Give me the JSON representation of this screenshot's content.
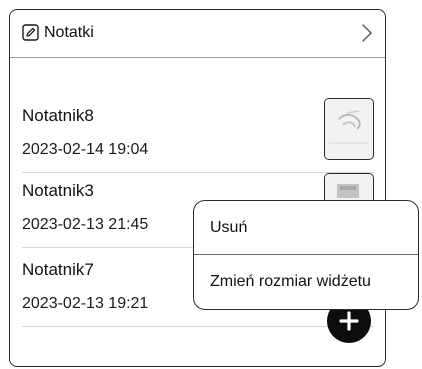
{
  "widget": {
    "title": "Notatki",
    "header_icon": "note-edit-icon",
    "chevron_icon": "chevron-right-icon"
  },
  "notes": [
    {
      "title": "Notatnik8",
      "date": "2023-02-14 19:04"
    },
    {
      "title": "Notatnik3",
      "date": "2023-02-13 21:45"
    },
    {
      "title": "Notatnik7",
      "date": "2023-02-13 19:21"
    }
  ],
  "context_menu": {
    "items": [
      {
        "label": "Usuń"
      },
      {
        "label": "Zmień rozmiar widżetu"
      }
    ]
  },
  "fab": {
    "icon": "plus-icon"
  }
}
